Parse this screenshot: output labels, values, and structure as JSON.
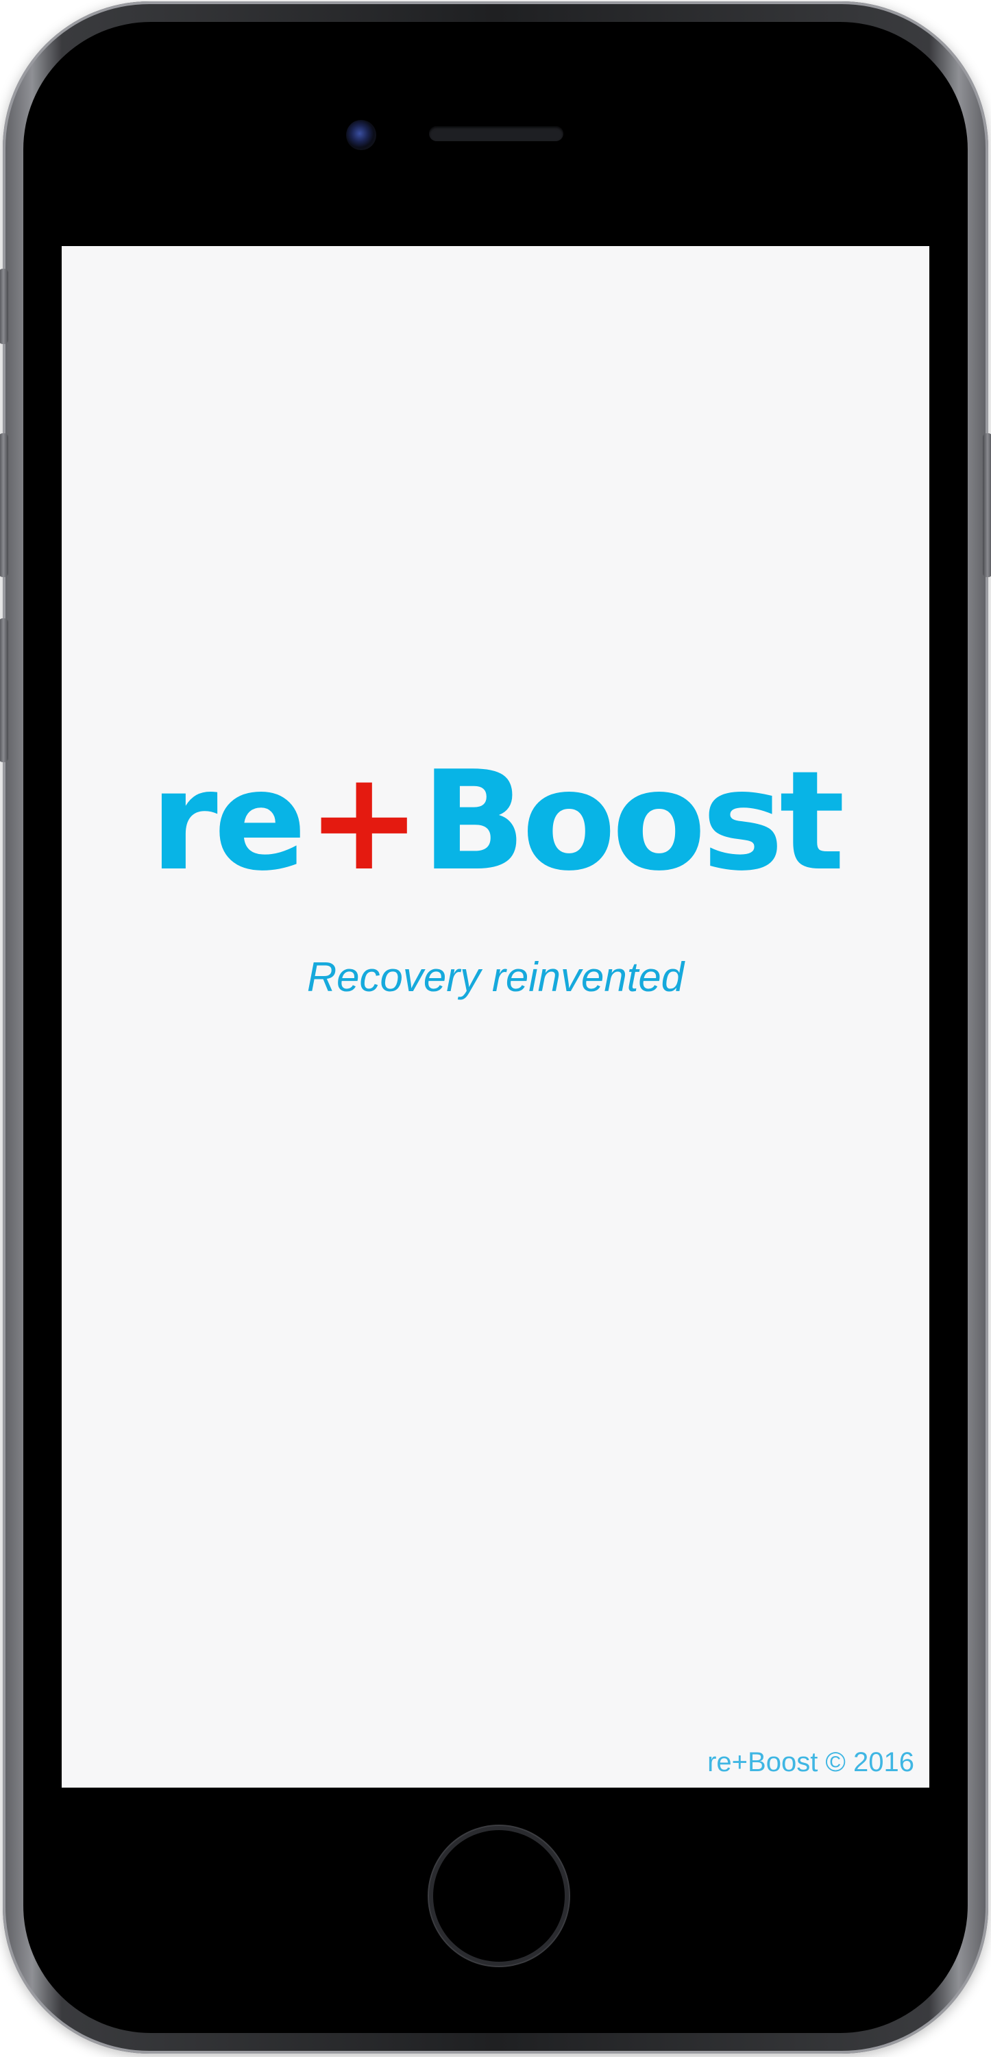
{
  "app": {
    "logo": {
      "part_re": "re",
      "part_plus": "+",
      "part_boost": "Boost",
      "brand_color": "#08b4e6",
      "accent_color": "#e41a10"
    },
    "tagline": "Recovery reinvented",
    "footer": "re+Boost © 2016"
  },
  "device": {
    "icons": [
      "front-camera-icon",
      "earpiece-speaker-icon",
      "home-button-icon"
    ]
  }
}
